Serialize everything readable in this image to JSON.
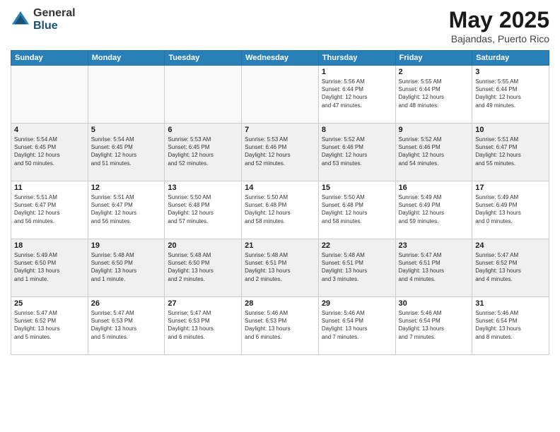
{
  "logo": {
    "general": "General",
    "blue": "Blue"
  },
  "title": {
    "month": "May 2025",
    "location": "Bajandas, Puerto Rico"
  },
  "weekdays": [
    "Sunday",
    "Monday",
    "Tuesday",
    "Wednesday",
    "Thursday",
    "Friday",
    "Saturday"
  ],
  "weeks": [
    [
      {
        "day": "",
        "info": ""
      },
      {
        "day": "",
        "info": ""
      },
      {
        "day": "",
        "info": ""
      },
      {
        "day": "",
        "info": ""
      },
      {
        "day": "1",
        "info": "Sunrise: 5:56 AM\nSunset: 6:44 PM\nDaylight: 12 hours\nand 47 minutes."
      },
      {
        "day": "2",
        "info": "Sunrise: 5:55 AM\nSunset: 6:44 PM\nDaylight: 12 hours\nand 48 minutes."
      },
      {
        "day": "3",
        "info": "Sunrise: 5:55 AM\nSunset: 6:44 PM\nDaylight: 12 hours\nand 49 minutes."
      }
    ],
    [
      {
        "day": "4",
        "info": "Sunrise: 5:54 AM\nSunset: 6:45 PM\nDaylight: 12 hours\nand 50 minutes."
      },
      {
        "day": "5",
        "info": "Sunrise: 5:54 AM\nSunset: 6:45 PM\nDaylight: 12 hours\nand 51 minutes."
      },
      {
        "day": "6",
        "info": "Sunrise: 5:53 AM\nSunset: 6:45 PM\nDaylight: 12 hours\nand 52 minutes."
      },
      {
        "day": "7",
        "info": "Sunrise: 5:53 AM\nSunset: 6:46 PM\nDaylight: 12 hours\nand 52 minutes."
      },
      {
        "day": "8",
        "info": "Sunrise: 5:52 AM\nSunset: 6:46 PM\nDaylight: 12 hours\nand 53 minutes."
      },
      {
        "day": "9",
        "info": "Sunrise: 5:52 AM\nSunset: 6:46 PM\nDaylight: 12 hours\nand 54 minutes."
      },
      {
        "day": "10",
        "info": "Sunrise: 5:51 AM\nSunset: 6:47 PM\nDaylight: 12 hours\nand 55 minutes."
      }
    ],
    [
      {
        "day": "11",
        "info": "Sunrise: 5:51 AM\nSunset: 6:47 PM\nDaylight: 12 hours\nand 56 minutes."
      },
      {
        "day": "12",
        "info": "Sunrise: 5:51 AM\nSunset: 6:47 PM\nDaylight: 12 hours\nand 56 minutes."
      },
      {
        "day": "13",
        "info": "Sunrise: 5:50 AM\nSunset: 6:48 PM\nDaylight: 12 hours\nand 57 minutes."
      },
      {
        "day": "14",
        "info": "Sunrise: 5:50 AM\nSunset: 6:48 PM\nDaylight: 12 hours\nand 58 minutes."
      },
      {
        "day": "15",
        "info": "Sunrise: 5:50 AM\nSunset: 6:48 PM\nDaylight: 12 hours\nand 58 minutes."
      },
      {
        "day": "16",
        "info": "Sunrise: 5:49 AM\nSunset: 6:49 PM\nDaylight: 12 hours\nand 59 minutes."
      },
      {
        "day": "17",
        "info": "Sunrise: 5:49 AM\nSunset: 6:49 PM\nDaylight: 13 hours\nand 0 minutes."
      }
    ],
    [
      {
        "day": "18",
        "info": "Sunrise: 5:49 AM\nSunset: 6:50 PM\nDaylight: 13 hours\nand 1 minute."
      },
      {
        "day": "19",
        "info": "Sunrise: 5:48 AM\nSunset: 6:50 PM\nDaylight: 13 hours\nand 1 minute."
      },
      {
        "day": "20",
        "info": "Sunrise: 5:48 AM\nSunset: 6:50 PM\nDaylight: 13 hours\nand 2 minutes."
      },
      {
        "day": "21",
        "info": "Sunrise: 5:48 AM\nSunset: 6:51 PM\nDaylight: 13 hours\nand 2 minutes."
      },
      {
        "day": "22",
        "info": "Sunrise: 5:48 AM\nSunset: 6:51 PM\nDaylight: 13 hours\nand 3 minutes."
      },
      {
        "day": "23",
        "info": "Sunrise: 5:47 AM\nSunset: 6:51 PM\nDaylight: 13 hours\nand 4 minutes."
      },
      {
        "day": "24",
        "info": "Sunrise: 5:47 AM\nSunset: 6:52 PM\nDaylight: 13 hours\nand 4 minutes."
      }
    ],
    [
      {
        "day": "25",
        "info": "Sunrise: 5:47 AM\nSunset: 6:52 PM\nDaylight: 13 hours\nand 5 minutes."
      },
      {
        "day": "26",
        "info": "Sunrise: 5:47 AM\nSunset: 6:53 PM\nDaylight: 13 hours\nand 5 minutes."
      },
      {
        "day": "27",
        "info": "Sunrise: 5:47 AM\nSunset: 6:53 PM\nDaylight: 13 hours\nand 6 minutes."
      },
      {
        "day": "28",
        "info": "Sunrise: 5:46 AM\nSunset: 6:53 PM\nDaylight: 13 hours\nand 6 minutes."
      },
      {
        "day": "29",
        "info": "Sunrise: 5:46 AM\nSunset: 6:54 PM\nDaylight: 13 hours\nand 7 minutes."
      },
      {
        "day": "30",
        "info": "Sunrise: 5:46 AM\nSunset: 6:54 PM\nDaylight: 13 hours\nand 7 minutes."
      },
      {
        "day": "31",
        "info": "Sunrise: 5:46 AM\nSunset: 6:54 PM\nDaylight: 13 hours\nand 8 minutes."
      }
    ]
  ]
}
